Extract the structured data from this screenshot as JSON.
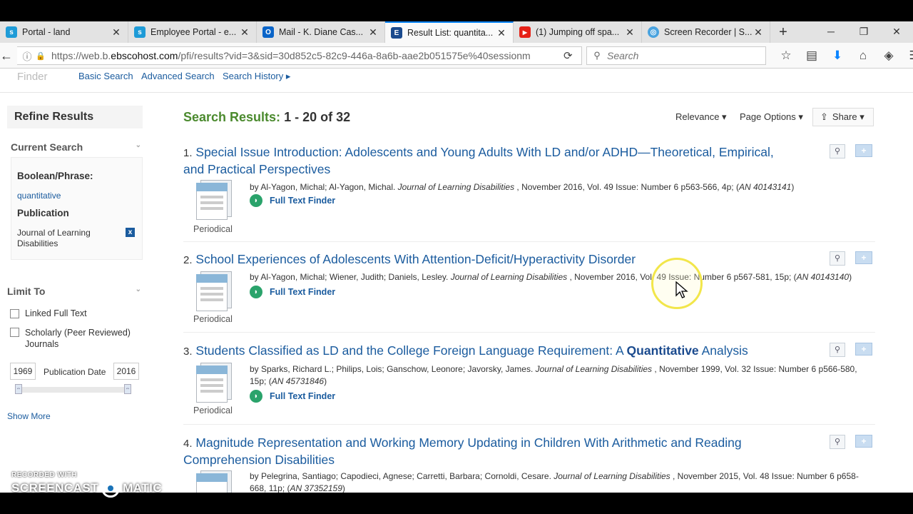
{
  "browser": {
    "tabs": [
      {
        "label": "Portal - land",
        "icon": "s",
        "color": "#1e9bd7"
      },
      {
        "label": "Employee Portal - e...",
        "icon": "s",
        "color": "#1e9bd7"
      },
      {
        "label": "Mail - K. Diane Cas...",
        "icon": "O",
        "color": "#0a64c8"
      },
      {
        "label": "Result List: quantita...",
        "icon": "E",
        "color": "#1a4a8e"
      },
      {
        "label": "(1) Jumping off spa...",
        "icon": "▶",
        "color": "#e62117"
      },
      {
        "label": "Screen Recorder | S...",
        "icon": "◎",
        "color": "#4aa3df"
      }
    ],
    "active_tab": 3,
    "url_prefix": "https://web.b.",
    "url_domain": "ebscohost.com",
    "url_rest": "/pfi/results?vid=3&sid=30d852c5-82c9-446a-8a6b-aae2b051575e%40sessionm",
    "search_placeholder": "Search"
  },
  "topnav": {
    "finder": "Finder",
    "basic_search": "Basic Search",
    "advanced_search": "Advanced Search",
    "search_history": "Search History ▸"
  },
  "sidebar": {
    "refine_title": "Refine Results",
    "current_search": "Current Search",
    "boolean_label": "Boolean/Phrase:",
    "boolean_value": "quantitative",
    "publication_label": "Publication",
    "publication_value": "Journal of Learning Disabilities",
    "limit_to": "Limit To",
    "linked_full_text": "Linked Full Text",
    "scholarly": "Scholarly (Peer Reviewed) Journals",
    "year_from": "1969",
    "year_to": "2016",
    "pub_date_label": "Publication Date",
    "show_more": "Show More"
  },
  "results": {
    "label": "Search Results:",
    "range": "1 - 20 of 32",
    "relevance": "Relevance ▾",
    "page_options": "Page Options ▾",
    "share": "Share ▾",
    "items": [
      {
        "num": "1.",
        "title": "Special Issue Introduction: Adolescents and Young Adults With LD and/or ADHD—Theoretical, Empirical, and Practical Perspectives",
        "by": "by Al-Yagon, Michal; Al-Yagon, Michal. ",
        "journal": "Journal of Learning Disabilities",
        "details": " , November 2016, Vol. 49 Issue: Number 6 p563-566, 4p; (",
        "an": "AN 40143141",
        "end": ")",
        "type": "Periodical",
        "ftf": "Full Text Finder"
      },
      {
        "num": "2.",
        "title": "School Experiences of Adolescents With Attention-Deficit/Hyperactivity Disorder",
        "by": "by Al-Yagon, Michal; Wiener, Judith; Daniels, Lesley. ",
        "journal": "Journal of Learning Disabilities",
        "details": " , November 2016, Vol. 49 Issue: Number 6 p567-581, 15p; (",
        "an": "AN 40143140",
        "end": ")",
        "type": "Periodical",
        "ftf": "Full Text Finder"
      },
      {
        "num": "3.",
        "title_pre": "Students Classified as LD and the College Foreign Language Requirement: A ",
        "title_bold": "Quantitative",
        "title_post": " Analysis",
        "by": "by Sparks, Richard L.; Philips, Lois; Ganschow, Leonore; Javorsky, James. ",
        "journal": "Journal of Learning Disabilities",
        "details": " , November 1999, Vol. 32 Issue: Number 6 p566-580, 15p; (",
        "an": "AN 45731846",
        "end": ")",
        "type": "Periodical",
        "ftf": "Full Text Finder"
      },
      {
        "num": "4.",
        "title": "Magnitude Representation and Working Memory Updating in Children With Arithmetic and Reading Comprehension Disabilities",
        "by": "by Pelegrina, Santiago; Capodieci, Agnese; Carretti, Barbara; Cornoldi, Cesare. ",
        "journal": "Journal of Learning Disabilities",
        "details": " , November 2015, Vol. 48 Issue: Number 6 p658-668, 11p; (",
        "an": "AN 37352159",
        "end": ")"
      }
    ]
  },
  "watermark": {
    "line1": "RECORDED WITH",
    "line2a": "SCREENCAST",
    "line2b": "MATIC"
  }
}
